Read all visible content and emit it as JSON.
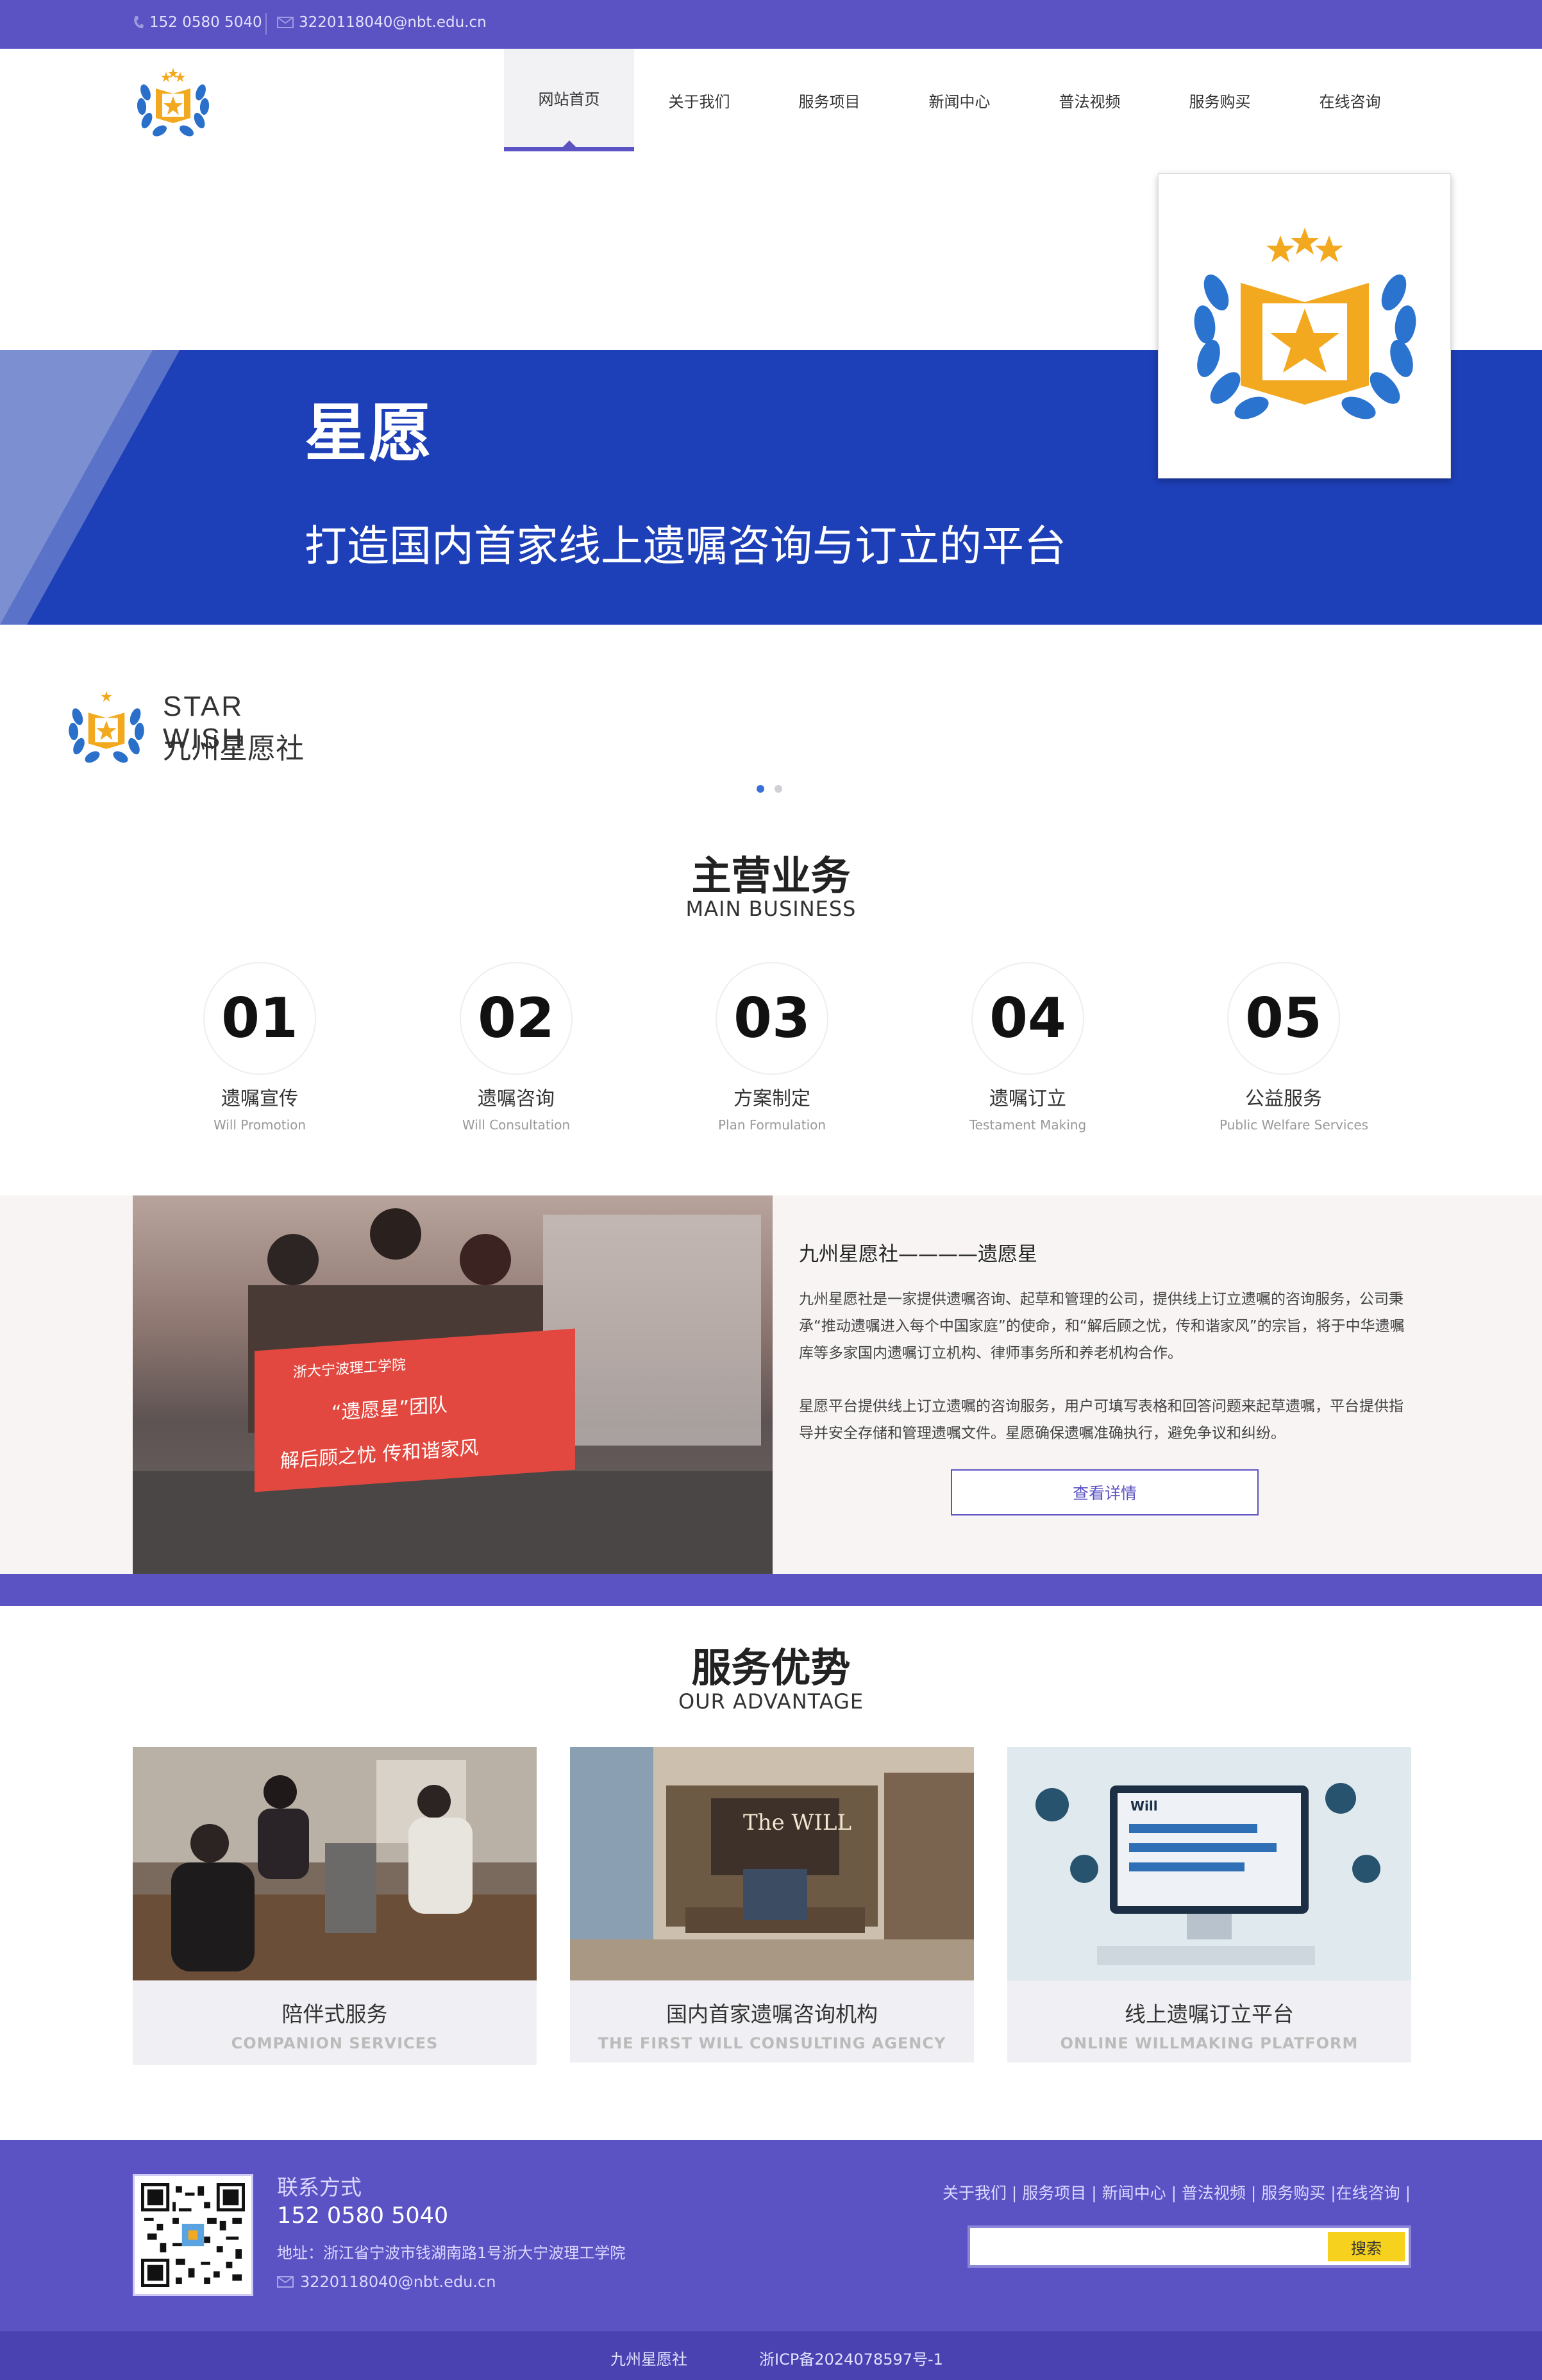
{
  "topbar": {
    "phone": "152 0580 5040",
    "email": "3220118040@nbt.edu.cn"
  },
  "nav": {
    "items": [
      "网站首页",
      "关于我们",
      "服务项目",
      "新闻中心",
      "普法视频",
      "服务购买",
      "在线咨询"
    ],
    "active": "网站首页"
  },
  "banner": {
    "title": "星愿",
    "subtitle": "打造国内首家线上遗嘱咨询与订立的平台"
  },
  "brand": {
    "en": "STAR WISH",
    "cn": "九州星愿社"
  },
  "business": {
    "title": "主营业务",
    "subtitle": "MAIN BUSINESS",
    "items": [
      {
        "num": "01",
        "cn": "遗嘱宣传",
        "en": "Will Promotion"
      },
      {
        "num": "02",
        "cn": "遗嘱咨询",
        "en": "Will Consultation"
      },
      {
        "num": "03",
        "cn": "方案制定",
        "en": "Plan Formulation"
      },
      {
        "num": "04",
        "cn": "遗嘱订立",
        "en": "Testament Making"
      },
      {
        "num": "05",
        "cn": "公益服务",
        "en": "Public Welfare Services"
      }
    ]
  },
  "about": {
    "heading": "九州星愿社————遗愿星",
    "p1": "九州星愿社是一家提供遗嘱咨询、起草和管理的公司，提供线上订立遗嘱的咨询服务，公司秉承“推动遗嘱进入每个中国家庭”的使命，和“解后顾之忧，传和谐家风”的宗旨，将于中华遗嘱库等多家国内遗嘱订立机构、律师事务所和养老机构合作。",
    "p2": "星愿平台提供线上订立遗嘱的咨询服务，用户可填写表格和回答问题来起草遗嘱，平台提供指导并安全存储和管理遗嘱文件。星愿确保遗嘱准确执行，避免争议和纠纷。",
    "button": "查看详情",
    "banner_text": [
      "浙大宁波理工学院",
      "“遗愿星”团队",
      "解后顾之忧 传和谐家风"
    ]
  },
  "advantage": {
    "title": "服务优势",
    "subtitle": "OUR ADVANTAGE",
    "cards": [
      {
        "cn": "陪伴式服务",
        "en": "COMPANION SERVICES"
      },
      {
        "cn": "国内首家遗嘱咨询机构",
        "en": "THE FIRST WILL CONSULTING AGENCY",
        "img_text": "The WILL"
      },
      {
        "cn": "线上遗嘱订立平台",
        "en": "ONLINE WILLMAKING PLATFORM",
        "img_text": "Will"
      }
    ]
  },
  "footer": {
    "heading": "联系方式",
    "phone": "152 0580 5040",
    "address": "地址：浙江省宁波市钱湖南路1号浙大宁波理工学院",
    "email": "3220118040@nbt.edu.cn",
    "links": "关于我们 | 服务项目 | 新闻中心 | 普法视频 | 服务购买 |在线咨询 |",
    "search_button": "搜索"
  },
  "bottom": {
    "name": "九州星愿社",
    "icp": "浙ICP备2024078597号-1"
  },
  "colors": {
    "primary": "#5b52c4",
    "banner_blue": "#1d3fb7",
    "button_yellow": "#f6d21e"
  }
}
